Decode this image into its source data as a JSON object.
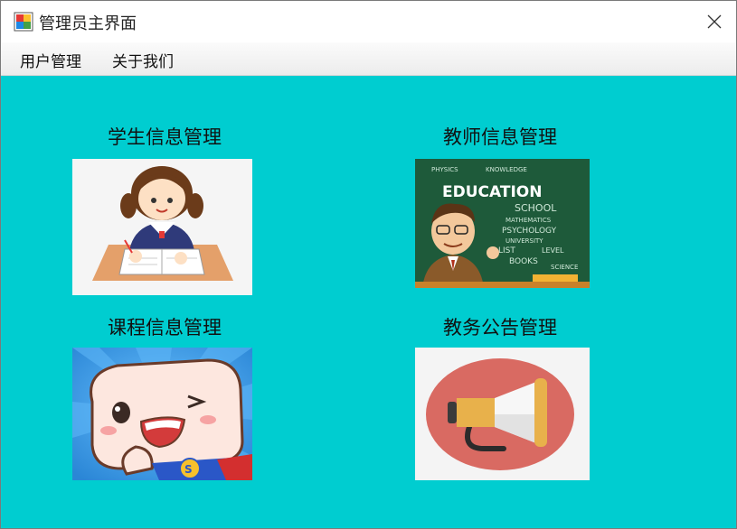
{
  "window": {
    "title": "管理员主界面"
  },
  "menu": {
    "items": [
      "用户管理",
      "关于我们"
    ]
  },
  "tiles": [
    {
      "label": "学生信息管理",
      "icon": "student-studying-icon"
    },
    {
      "label": "教师信息管理",
      "icon": "teacher-chalkboard-icon"
    },
    {
      "label": "课程信息管理",
      "icon": "winking-cube-mascot-icon"
    },
    {
      "label": "教务公告管理",
      "icon": "megaphone-icon"
    }
  ],
  "education_board": {
    "headline": "EDUCATION",
    "words": [
      "PHYSICS",
      "KNOWLEDGE",
      "SCHOOL",
      "MATHEMATICS",
      "PSYCHOLOGY",
      "UNIVERSITY",
      "LIST",
      "LEVEL",
      "BOOKS",
      "SCIENCE"
    ]
  },
  "colors": {
    "content_bg": "#00cdd0",
    "board": "#1e5a3a",
    "megaphone_bg": "#d96a62"
  }
}
